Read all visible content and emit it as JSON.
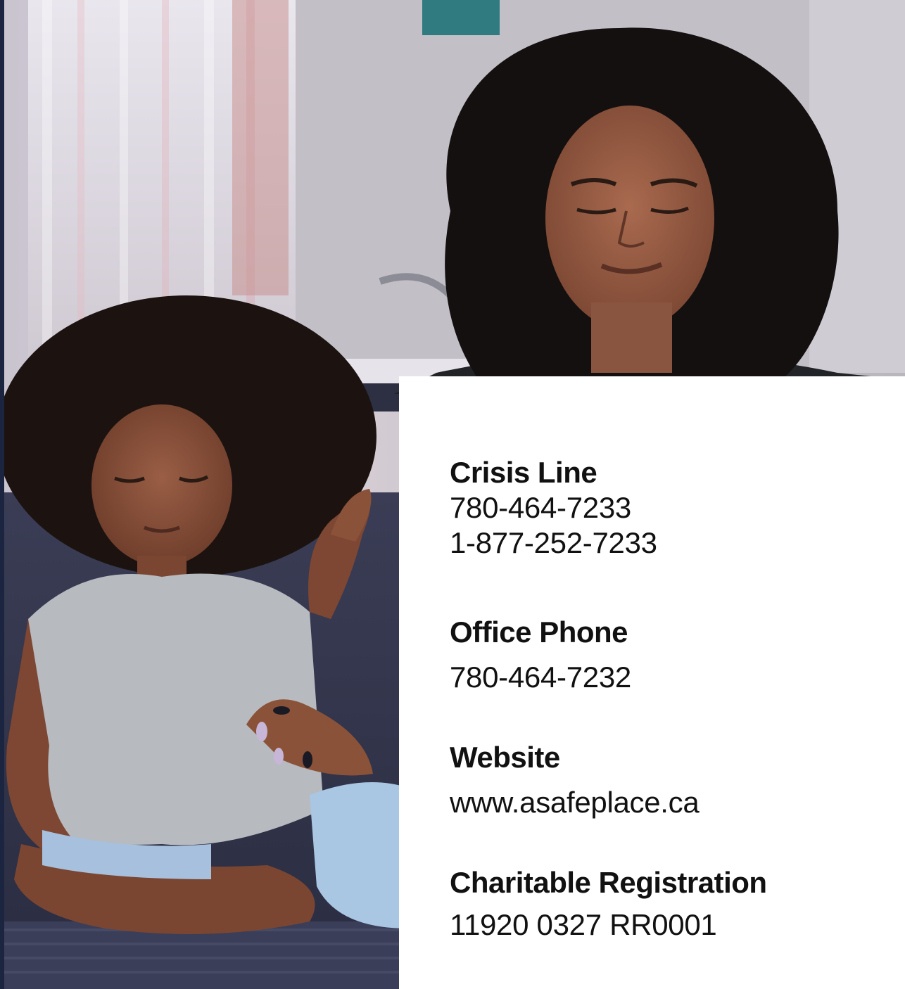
{
  "contact": {
    "crisis_line": {
      "heading": "Crisis Line",
      "numbers": [
        "780-464-7233",
        "1-877-252-7233"
      ]
    },
    "office_phone": {
      "heading": "Office Phone",
      "number": "780-464-7232"
    },
    "website": {
      "heading": "Website",
      "url": "www.asafeplace.ca"
    },
    "charitable_registration": {
      "heading": "Charitable Registration",
      "number": "11920 0327 RR0001"
    }
  },
  "colors": {
    "background_navy": "#1d2a44",
    "panel": "#ffffff",
    "text": "#111111"
  }
}
